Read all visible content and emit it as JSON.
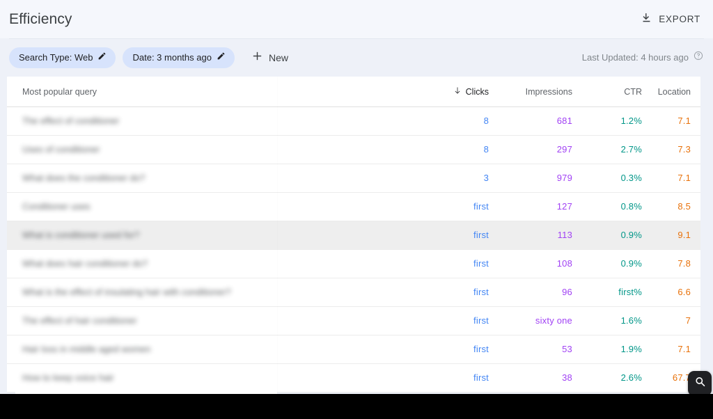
{
  "header": {
    "title": "Efficiency",
    "export_label": "EXPORT",
    "export_icon": "download-icon"
  },
  "filters": {
    "chips": [
      {
        "label": "Search Type: Web",
        "edit_icon": "pencil-icon"
      },
      {
        "label": "Date: 3 months ago",
        "edit_icon": "pencil-icon"
      }
    ],
    "new_label": "New",
    "new_icon": "plus-icon",
    "last_updated": "Last Updated: 4 hours ago",
    "help_icon": "help-circle-icon"
  },
  "table": {
    "columns": [
      {
        "key": "query",
        "label": "Most popular query",
        "align": "left",
        "sorted": false
      },
      {
        "key": "clicks",
        "label": "Clicks",
        "align": "right",
        "sorted": true,
        "sort_dir": "desc",
        "sort_icon": "arrow-down-icon"
      },
      {
        "key": "impressions",
        "label": "Impressions",
        "align": "right",
        "sorted": false
      },
      {
        "key": "ctr",
        "label": "CTR",
        "align": "right",
        "sorted": false
      },
      {
        "key": "location",
        "label": "Location",
        "align": "right",
        "sorted": false
      }
    ],
    "rows": [
      {
        "query": "The effect of conditioner",
        "clicks": "8",
        "impressions": "681",
        "ctr": "1.2%",
        "location": "7.1",
        "highlighted": false
      },
      {
        "query": "Uses of conditioner",
        "clicks": "8",
        "impressions": "297",
        "ctr": "2.7%",
        "location": "7.3",
        "highlighted": false
      },
      {
        "query": "What does the conditioner do?",
        "clicks": "3",
        "impressions": "979",
        "ctr": "0.3%",
        "location": "7.1",
        "highlighted": false
      },
      {
        "query": "Conditioner uses",
        "clicks": "first",
        "impressions": "127",
        "ctr": "0.8%",
        "location": "8.5",
        "highlighted": false
      },
      {
        "query": "What is conditioner used for?",
        "clicks": "first",
        "impressions": "113",
        "ctr": "0.9%",
        "location": "9.1",
        "highlighted": true
      },
      {
        "query": "What does hair conditioner do?",
        "clicks": "first",
        "impressions": "108",
        "ctr": "0.9%",
        "location": "7.8",
        "highlighted": false
      },
      {
        "query": "What is the effect of insulating hair with conditioner?",
        "clicks": "first",
        "impressions": "96",
        "ctr": "first%",
        "location": "6.6",
        "highlighted": false
      },
      {
        "query": "The effect of hair conditioner",
        "clicks": "first",
        "impressions": "sixty one",
        "ctr": "1.6%",
        "location": "7",
        "highlighted": false
      },
      {
        "query": "Hair loss in middle aged women",
        "clicks": "first",
        "impressions": "53",
        "ctr": "1.9%",
        "location": "7.1",
        "highlighted": false
      },
      {
        "query": "How to keep voice hair",
        "clicks": "first",
        "impressions": "38",
        "ctr": "2.6%",
        "location": "67.7",
        "highlighted": false
      }
    ]
  },
  "floating_widget": {
    "icon": "search-badge-icon"
  },
  "colors": {
    "clicks": "#4285f4",
    "impressions": "#a142f4",
    "ctr": "#009688",
    "location": "#e8710a",
    "chip_bg": "#d7e3fc",
    "page_bg": "#eef1f8",
    "card_bg": "#ffffff",
    "row_highlight": "#eeeeee"
  }
}
